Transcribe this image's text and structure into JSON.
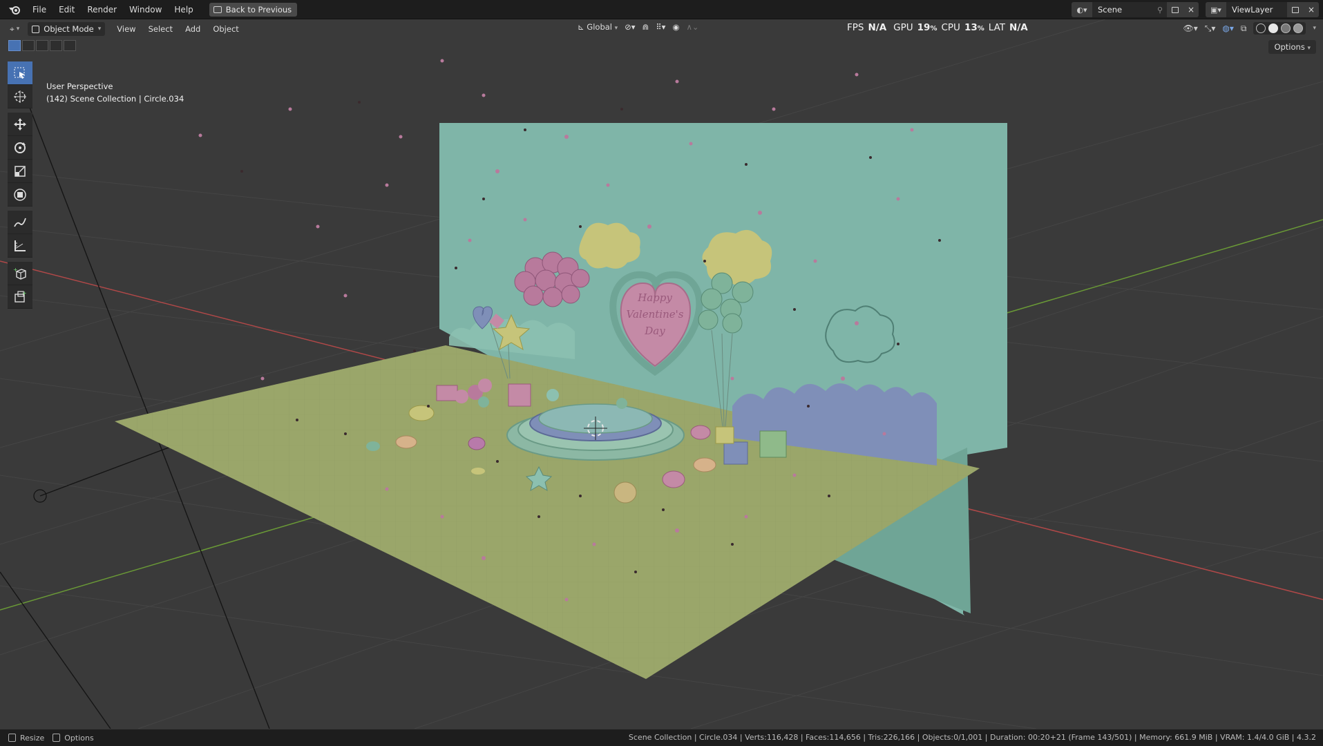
{
  "topbar": {
    "menus": [
      "File",
      "Edit",
      "Render",
      "Window",
      "Help"
    ],
    "back_button": "Back to Previous",
    "scene_name": "Scene",
    "view_layer": "ViewLayer"
  },
  "header": {
    "mode": "Object Mode",
    "menus": [
      "View",
      "Select",
      "Add",
      "Object"
    ],
    "orientation": "Global",
    "perf": {
      "fps_label": "FPS",
      "fps_value": "N/A",
      "gpu_label": "GPU",
      "gpu_value": "19",
      "cpu_label": "CPU",
      "cpu_value": "13",
      "lat_label": "LAT",
      "lat_value": "N/A",
      "pct": "%"
    },
    "options": "Options"
  },
  "viewport": {
    "perspective": "User Perspective",
    "collection_info": "(142) Scene Collection | Circle.034",
    "sign_text": [
      "Happy",
      "Valentine's",
      "Day"
    ]
  },
  "toolbar": {
    "tools": [
      "select-box",
      "cursor",
      "move",
      "rotate",
      "scale",
      "transform",
      "annotate",
      "measure",
      "add-cube",
      "add-object"
    ]
  },
  "statusbar": {
    "resize": "Resize",
    "options": "Options",
    "stats": "Scene Collection | Circle.034 | Verts:116,428 | Faces:114,656 | Tris:226,166 | Objects:0/1,001 | Duration: 00:20+21 (Frame 143/501) | Memory: 661.9 MiB | VRAM: 1.4/4.0 GiB | 4.3.2"
  },
  "colors": {
    "wall": "#7fb5a8",
    "floor": "#9aa66a",
    "heart": "#c48aa6",
    "active_tool": "#4772b3"
  }
}
